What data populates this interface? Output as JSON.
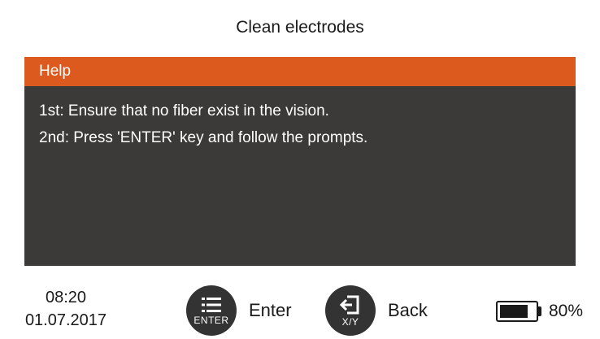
{
  "screen": {
    "title": "Clean electrodes"
  },
  "help": {
    "header": "Help",
    "lines": [
      "1st: Ensure that no fiber exist in the vision.",
      "2nd: Press 'ENTER' key and follow the prompts."
    ]
  },
  "status": {
    "time": "08:20",
    "date": "01.07.2017"
  },
  "softkeys": {
    "enter": {
      "icon": "menu-list-icon",
      "tag": "ENTER",
      "label": "Enter"
    },
    "back": {
      "icon": "back-exit-icon",
      "tag": "X/Y",
      "label": "Back"
    }
  },
  "battery": {
    "level": 0.8,
    "text": "80%"
  },
  "colors": {
    "header_orange": "#dd5a1e",
    "panel_bg": "#3b3a38",
    "key_bg": "#333333"
  }
}
